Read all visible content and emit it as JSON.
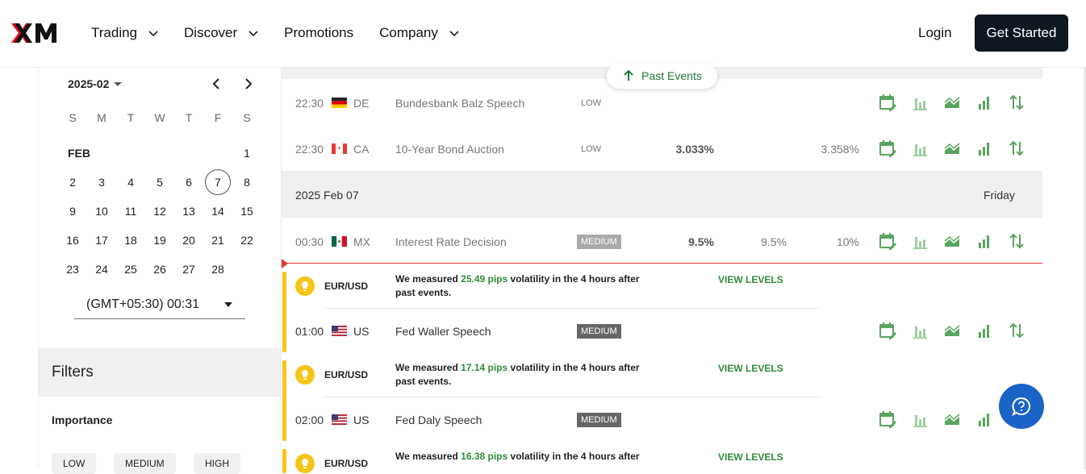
{
  "header": {
    "nav": [
      {
        "label": "Trading",
        "has_dropdown": true
      },
      {
        "label": "Discover",
        "has_dropdown": true
      },
      {
        "label": "Promotions",
        "has_dropdown": false
      },
      {
        "label": "Company",
        "has_dropdown": true
      }
    ],
    "login_label": "Login",
    "get_started_label": "Get Started"
  },
  "calendar": {
    "month_select": "2025-02",
    "weekdays": [
      "S",
      "M",
      "T",
      "W",
      "T",
      "F",
      "S"
    ],
    "month_label": "FEB",
    "weeks": [
      [
        "",
        "",
        "",
        "",
        "",
        "",
        "1"
      ],
      [
        "2",
        "3",
        "4",
        "5",
        "6",
        "7",
        "8"
      ],
      [
        "9",
        "10",
        "11",
        "12",
        "13",
        "14",
        "15"
      ],
      [
        "16",
        "17",
        "18",
        "19",
        "20",
        "21",
        "22"
      ],
      [
        "23",
        "24",
        "25",
        "26",
        "27",
        "28",
        ""
      ]
    ],
    "selected_day": "7",
    "timezone": "(GMT+05:30) 00:31"
  },
  "filters": {
    "title": "Filters",
    "importance_label": "Importance",
    "importance_options": [
      "LOW",
      "MEDIUM",
      "HIGH"
    ]
  },
  "past_events_label": "Past Events",
  "events_past": [
    {
      "time": "22:30",
      "country": "DE",
      "event": "Bundesbank Balz Speech",
      "importance": "LOW",
      "actual": "",
      "forecast": "",
      "previous": ""
    },
    {
      "time": "22:30",
      "country": "CA",
      "event": "10-Year Bond Auction",
      "importance": "LOW",
      "actual": "3.033%",
      "forecast": "",
      "previous": "3.358%"
    }
  ],
  "date_row": {
    "date": "2025 Feb 07",
    "weekday": "Friday"
  },
  "event_mx": {
    "time": "00:30",
    "country": "MX",
    "event": "Interest Rate Decision",
    "importance": "MEDIUM",
    "actual": "9.5%",
    "forecast": "9.5%",
    "previous": "10%"
  },
  "upcoming": [
    {
      "pair": "EUR/USD",
      "vol_prefix": "We measured ",
      "pips": "25.49 pips",
      "vol_suffix": " volatility in the 4 hours after past events.",
      "view_levels": "VIEW LEVELS",
      "time": "01:00",
      "country": "US",
      "event": "Fed Waller Speech",
      "importance": "MEDIUM"
    },
    {
      "pair": "EUR/USD",
      "vol_prefix": "We measured ",
      "pips": "17.14 pips",
      "vol_suffix": " volatility in the 4 hours after past events.",
      "view_levels": "VIEW LEVELS",
      "time": "02:00",
      "country": "US",
      "event": "Fed Daly Speech",
      "importance": "MEDIUM"
    },
    {
      "pair": "EUR/USD",
      "vol_prefix": "We measured ",
      "pips": "16.38 pips",
      "vol_suffix": " volatility in the 4 hours after",
      "view_levels": "VIEW LEVELS"
    }
  ],
  "colors": {
    "accent_green": "#2e8b3e",
    "icon_green": "#4caf50",
    "brand_dark": "#0f1721",
    "help_blue": "#1b63c6",
    "vol_yellow": "#f5c518"
  }
}
